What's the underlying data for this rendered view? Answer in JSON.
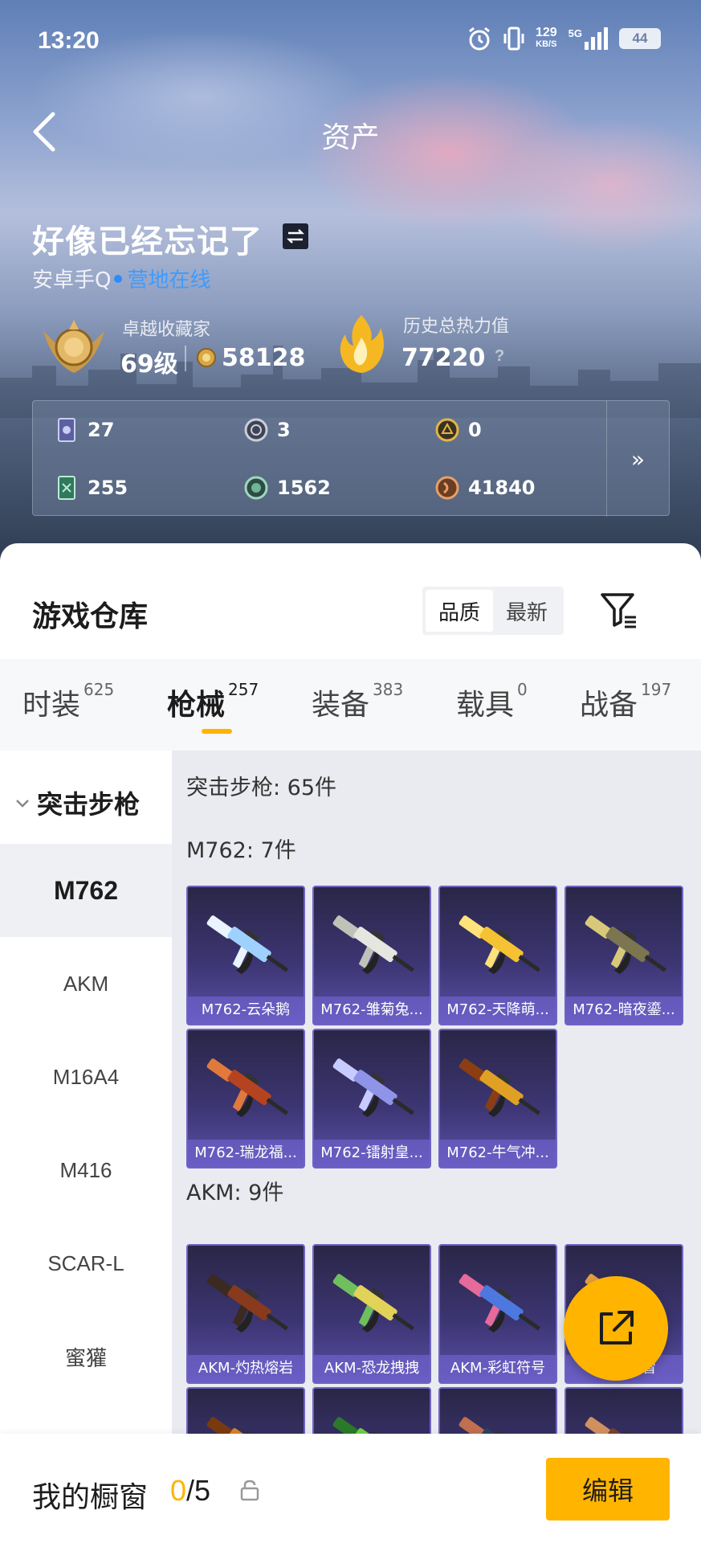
{
  "status_bar": {
    "time": "13:20",
    "net_speed": "129",
    "net_unit": "KB/S",
    "signal_label": "5G",
    "battery": "44"
  },
  "header": {
    "title": "资产"
  },
  "profile": {
    "name": "好像已经忘记了",
    "platform": "安卓手Q",
    "online_status": "营地在线",
    "collector_title": "卓越收藏家",
    "collector_level": "69级",
    "collector_points": "58128",
    "heat_label": "历史总热力值",
    "heat_value": "77220",
    "help": "?"
  },
  "resources": {
    "items": [
      {
        "icon": "purple-card-icon",
        "value": "27"
      },
      {
        "icon": "silver-coin-icon",
        "value": "3"
      },
      {
        "icon": "gold-emblem-icon",
        "value": "0"
      },
      {
        "icon": "green-card-icon",
        "value": "255"
      },
      {
        "icon": "green-coin-icon",
        "value": "1562"
      },
      {
        "icon": "bronze-coin-icon",
        "value": "41840"
      }
    ],
    "more": "»"
  },
  "warehouse": {
    "title": "游戏仓库",
    "sort_options": [
      "品质",
      "最新"
    ],
    "active_sort": "品质"
  },
  "tabs": [
    {
      "label": "时装",
      "count": "625"
    },
    {
      "label": "枪械",
      "count": "257",
      "active": true
    },
    {
      "label": "装备",
      "count": "383"
    },
    {
      "label": "载具",
      "count": "0"
    },
    {
      "label": "战备",
      "count": "197"
    }
  ],
  "subnav": {
    "group": "突击步枪",
    "items": [
      "M762",
      "AKM",
      "M16A4",
      "M416",
      "SCAR-L",
      "蜜獾"
    ],
    "active": "M762"
  },
  "content": {
    "header": "突击步枪: 65件",
    "groups": [
      {
        "title": "M762: 7件",
        "items": [
          "M762-云朵鹅",
          "M762-雏菊兔...",
          "M762-天降萌...",
          "M762-暗夜鎏...",
          "M762-瑞龙福...",
          "M762-镭射皇...",
          "M762-牛气冲..."
        ]
      },
      {
        "title": "AKM: 9件",
        "items": [
          "AKM-灼热熔岩",
          "AKM-恐龙拽拽",
          "AKM-彩虹符号",
          "AKM-...冒",
          "",
          "",
          "",
          ""
        ]
      }
    ]
  },
  "bottom": {
    "showcase_label": "我的橱窗",
    "showcase_current": "0",
    "showcase_total": "/5",
    "edit_label": "编辑"
  },
  "colors": {
    "accent": "#ffb400",
    "online": "#2b8cff",
    "card_bg": "#3c3572"
  }
}
